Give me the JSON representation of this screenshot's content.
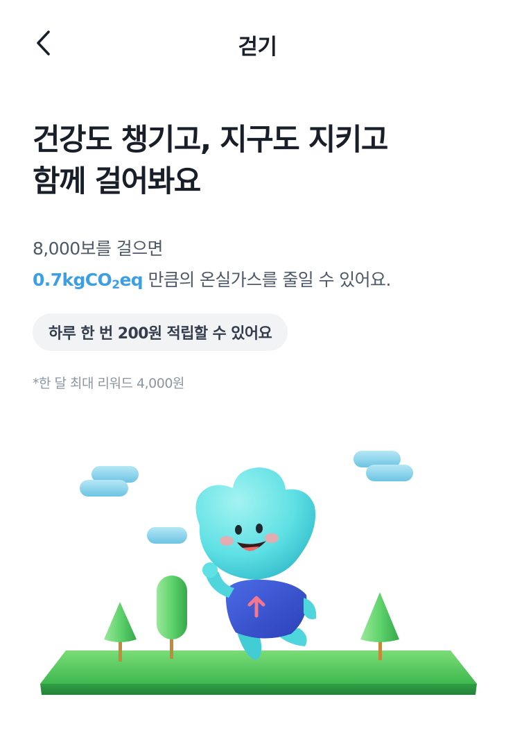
{
  "header": {
    "title": "걷기",
    "back_icon": "chevron-left-icon"
  },
  "headline": {
    "line1": "건강도 챙기고, 지구도 지키고",
    "line2": "함께 걸어봐요"
  },
  "description": {
    "line1": "8,000보를 걸으면",
    "accent_prefix": "0.7kgCO",
    "accent_sub": "2",
    "accent_suffix": "eq",
    "line2_rest": " 만큼의 온실가스를 줄일 수 있어요."
  },
  "reward_pill": {
    "label": "하루 한 번 200원 적립할 수 있어요"
  },
  "footnote": "*한 달 최대 리워드 4,000원",
  "colors": {
    "accent": "#3d9ee4",
    "text_primary": "#191f28",
    "text_secondary": "#4e5968",
    "text_tertiary": "#8b95a1",
    "pill_bg": "#f2f3f5",
    "ground": "#4cc25a",
    "tree": "#5fd36d",
    "character": "#5ee0e4",
    "shirt": "#3a57d8",
    "cloud": "#8fd5ec"
  }
}
